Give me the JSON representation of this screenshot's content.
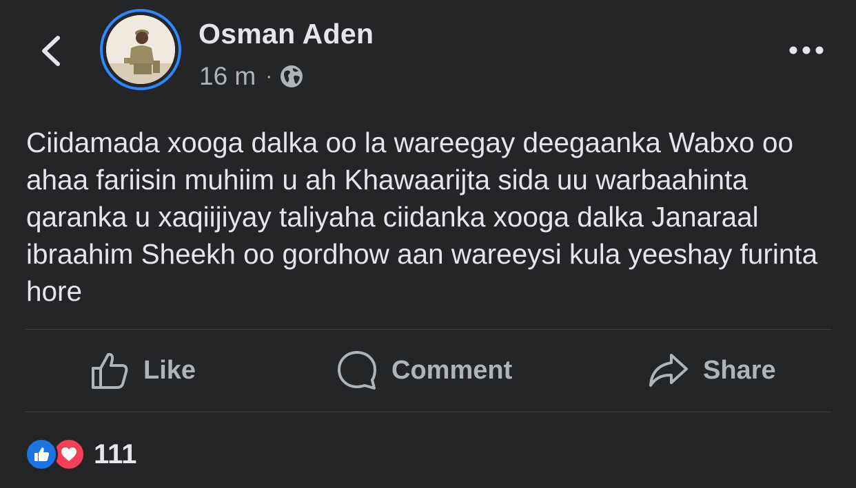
{
  "post": {
    "author_name": "Osman Aden",
    "time": "16 m",
    "separator": "·",
    "privacy_icon": "globe-icon",
    "text": "Ciidamada xooga dalka oo la wareegay deegaanka Wabxo oo ahaa fariisin muhiim u ah Khawaarijta sida uu warbaahinta qaranka u xaqiijiyay taliyaha ciidanka xooga dalka Janaraal ibraahim Sheekh oo gordhow aan wareeysi kula yeeshay furinta hore"
  },
  "actions": {
    "like_label": "Like",
    "comment_label": "Comment",
    "share_label": "Share"
  },
  "reactions": {
    "types": [
      "like",
      "love"
    ],
    "count": "111"
  },
  "colors": {
    "background": "#242526",
    "text_primary": "#e4e6eb",
    "text_secondary": "#b0b3b8",
    "story_ring": "#2d88ff",
    "like_blue": "#1b74e4",
    "love_red": "#f33e58"
  }
}
